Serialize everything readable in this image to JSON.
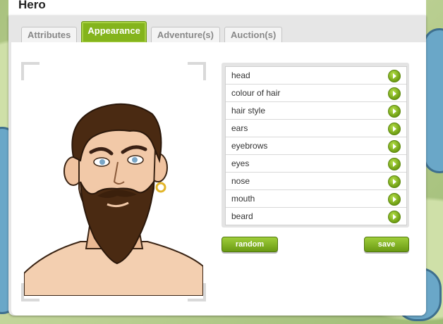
{
  "window": {
    "title": "Hero"
  },
  "tabs": [
    {
      "label": "Attributes",
      "active": false
    },
    {
      "label": "Appearance",
      "active": true
    },
    {
      "label": "Adventure(s)",
      "active": false
    },
    {
      "label": "Auction(s)",
      "active": false
    }
  ],
  "appearance_options": [
    {
      "label": "head"
    },
    {
      "label": "colour of hair"
    },
    {
      "label": "hair style"
    },
    {
      "label": "ears"
    },
    {
      "label": "eyebrows"
    },
    {
      "label": "eyes"
    },
    {
      "label": "nose"
    },
    {
      "label": "mouth"
    },
    {
      "label": "beard"
    }
  ],
  "buttons": {
    "random": "random",
    "save": "save"
  },
  "icons": {
    "option_arrow": "green-arrow-icon"
  },
  "colors": {
    "accent": "#84b41c",
    "hair": "#4a2a12",
    "skin": "#f2c9a8"
  }
}
